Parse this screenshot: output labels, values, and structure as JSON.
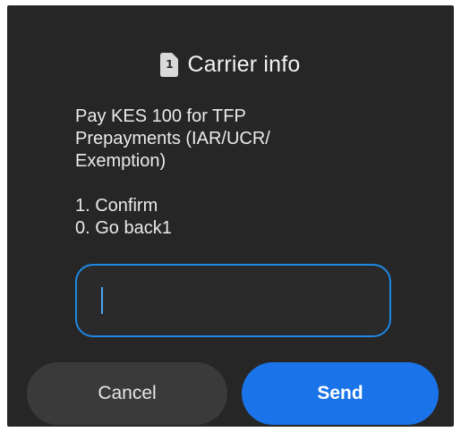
{
  "dialog": {
    "title": "Carrier info",
    "sim_slot": "1",
    "message_lines": [
      "Pay KES 100 for TFP",
      "Prepayments (IAR/UCR/",
      "Exemption)"
    ],
    "option_lines": [
      "1. Confirm",
      "0. Go back1"
    ],
    "input": {
      "value": ""
    },
    "buttons": {
      "cancel_label": "Cancel",
      "send_label": "Send"
    }
  },
  "colors": {
    "dialog_bg": "#262626",
    "accent": "#1a73e8",
    "input_border": "#1e88e5",
    "cancel_bg": "#3a3a3a"
  },
  "icons": {
    "sim": "sim-card-icon"
  }
}
